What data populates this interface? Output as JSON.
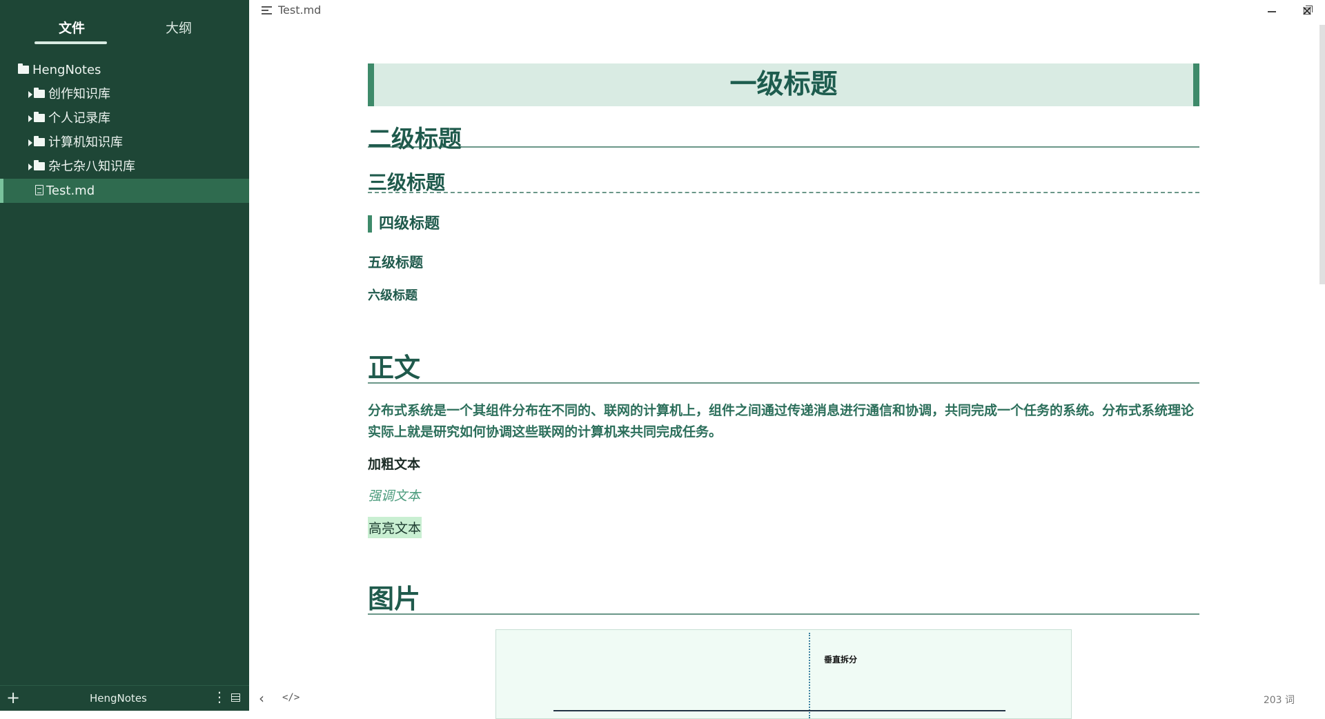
{
  "sidebar": {
    "tabs": [
      {
        "label": "文件",
        "active": true
      },
      {
        "label": "大纲",
        "active": false
      }
    ],
    "tree": [
      {
        "label": "HengNotes",
        "type": "folder",
        "level": 0
      },
      {
        "label": "创作知识库",
        "type": "folder",
        "level": 1
      },
      {
        "label": "个人记录库",
        "type": "folder",
        "level": 1
      },
      {
        "label": "计算机知识库",
        "type": "folder",
        "level": 1
      },
      {
        "label": "杂七杂八知识库",
        "type": "folder",
        "level": 1
      },
      {
        "label": "Test.md",
        "type": "file",
        "level": 1,
        "selected": true
      }
    ],
    "footer": {
      "add": "+",
      "vault": "HengNotes"
    }
  },
  "titlebar": {
    "title": "Test.md",
    "close": "✕"
  },
  "document": {
    "h1": "一级标题",
    "h2": "二级标题",
    "h3": "三级标题",
    "h4": "四级标题",
    "h5": "五级标题",
    "h6": "六级标题",
    "section_body": "正文",
    "paragraph": "分布式系统是一个其组件分布在不同的、联网的计算机上，组件之间通过传递消息进行通信和协调，共同完成一个任务的系统。分布式系统理论实际上就是研究如何协调这些联网的计算机来共同完成任务。",
    "bold_text": "加粗文本",
    "em_text": "强调文本",
    "highlight_text": "高亮文本",
    "section_image": "图片",
    "figure_label": "垂直拆分"
  },
  "bottombar": {
    "back": "‹",
    "source": "</>",
    "word_count": "203 词"
  },
  "colors": {
    "sidebar_bg": "#1e4636",
    "selected_row": "#2f6b4f",
    "heading": "#1d5c4e",
    "h1_bg": "#d9ebe3",
    "accent": "#3e8a6a",
    "highlight": "#c9efd2"
  },
  "icons": [
    "folder-icon",
    "file-icon",
    "chevron-right-icon",
    "menu-icon",
    "minimize-icon",
    "maximize-icon",
    "close-icon",
    "plus-icon",
    "more-icon",
    "panel-icon",
    "back-icon",
    "code-icon"
  ]
}
